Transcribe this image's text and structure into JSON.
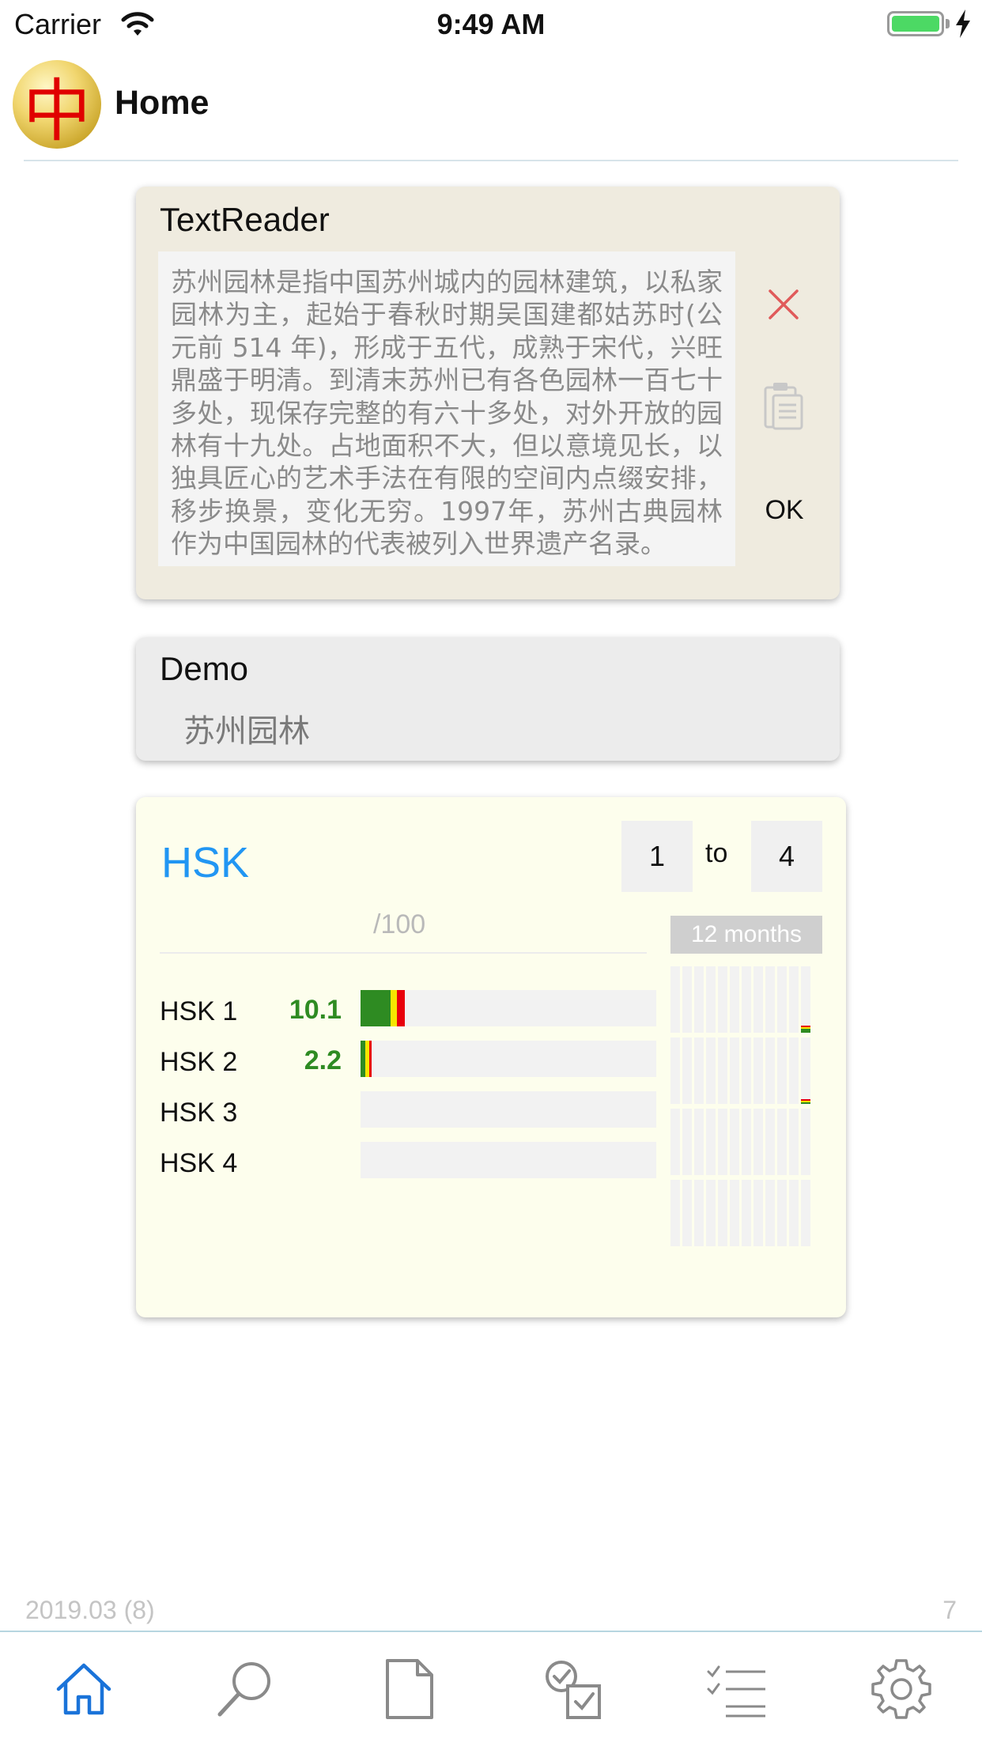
{
  "status_bar": {
    "carrier": "Carrier",
    "time": "9:49 AM"
  },
  "header": {
    "logo_char": "中",
    "title": "Home"
  },
  "text_reader": {
    "title": "TextReader",
    "text": "苏州园林是指中国苏州城内的园林建筑，以私家园林为主，起始于春秋时期吴国建都姑苏时(公元前 514 年)，形成于五代，成熟于宋代，兴旺鼎盛于明清。到清末苏州已有各色园林一百七十多处，现保存完整的有六十多处，对外开放的园林有十九处。占地面积不大，但以意境见长，以独具匠心的艺术手法在有限的空间内点缀安排，移步换景，变化无穷。1997年，苏州古典园林作为中国园林的代表被列入世界遗产名录。",
    "ok_label": "OK"
  },
  "demo": {
    "title": "Demo",
    "item": "苏州园林"
  },
  "hsk": {
    "title": "HSK",
    "level_from": "1",
    "to_label": "to",
    "level_to": "4",
    "score_suffix": "/100",
    "period": "12 months",
    "rows": [
      {
        "label": "HSK 1",
        "score": "10.1",
        "green": 0.102,
        "yellow": 0.022,
        "red": 0.025
      },
      {
        "label": "HSK 2",
        "score": "2.2",
        "green": 0.015,
        "yellow": 0.015,
        "red": 0.008
      },
      {
        "label": "HSK 3",
        "score": "",
        "green": 0,
        "yellow": 0,
        "red": 0
      },
      {
        "label": "HSK 4",
        "score": "",
        "green": 0,
        "yellow": 0,
        "red": 0
      }
    ],
    "colors": {
      "green": "#2e8b22",
      "yellow": "#f7e600",
      "red": "#e8000b",
      "accent": "#2196f3"
    }
  },
  "footer": {
    "date": "2019.03 (8)",
    "count": "7"
  },
  "tabs": [
    {
      "icon": "home-icon",
      "active": true
    },
    {
      "icon": "search-icon",
      "active": false
    },
    {
      "icon": "document-icon",
      "active": false
    },
    {
      "icon": "checklist-review-icon",
      "active": false
    },
    {
      "icon": "list-icon",
      "active": false
    },
    {
      "icon": "gear-icon",
      "active": false
    }
  ]
}
